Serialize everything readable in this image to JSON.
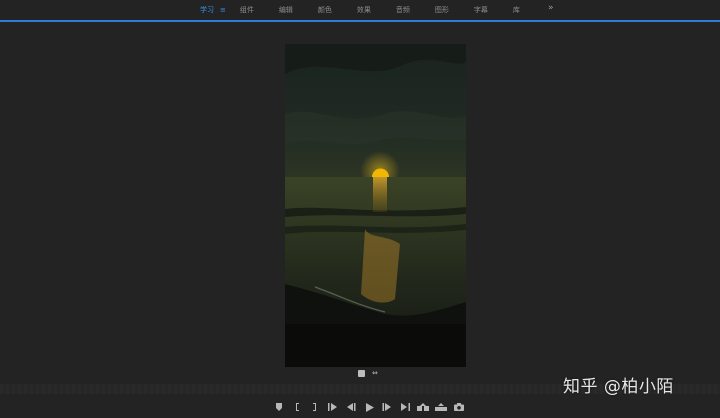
{
  "workspace_tabs": [
    {
      "label": "学习",
      "active": true
    },
    {
      "label": "组件",
      "active": false
    },
    {
      "label": "编辑",
      "active": false
    },
    {
      "label": "颜色",
      "active": false
    },
    {
      "label": "效果",
      "active": false
    },
    {
      "label": "音频",
      "active": false
    },
    {
      "label": "图形",
      "active": false
    },
    {
      "label": "字幕",
      "active": false
    },
    {
      "label": "库",
      "active": false
    }
  ],
  "workspace_menu_glyph": "≡",
  "overflow_glyph": "»",
  "colors": {
    "accent": "#2b7fd6",
    "active_tab": "#3a8ee6",
    "panel_bg": "#232323",
    "sun": "#f2b705"
  },
  "icons": {
    "marker": "marker-icon",
    "in_point": "mark-in-icon",
    "out_point": "mark-out-icon",
    "go_to_in": "go-to-in-icon",
    "step_back": "step-back-icon",
    "play": "play-icon",
    "step_forward": "step-forward-icon",
    "go_to_out": "go-to-out-icon",
    "insert": "insert-icon",
    "overwrite": "overwrite-icon",
    "export_frame": "camera-icon"
  },
  "watermark": "知乎 @柏小陌"
}
